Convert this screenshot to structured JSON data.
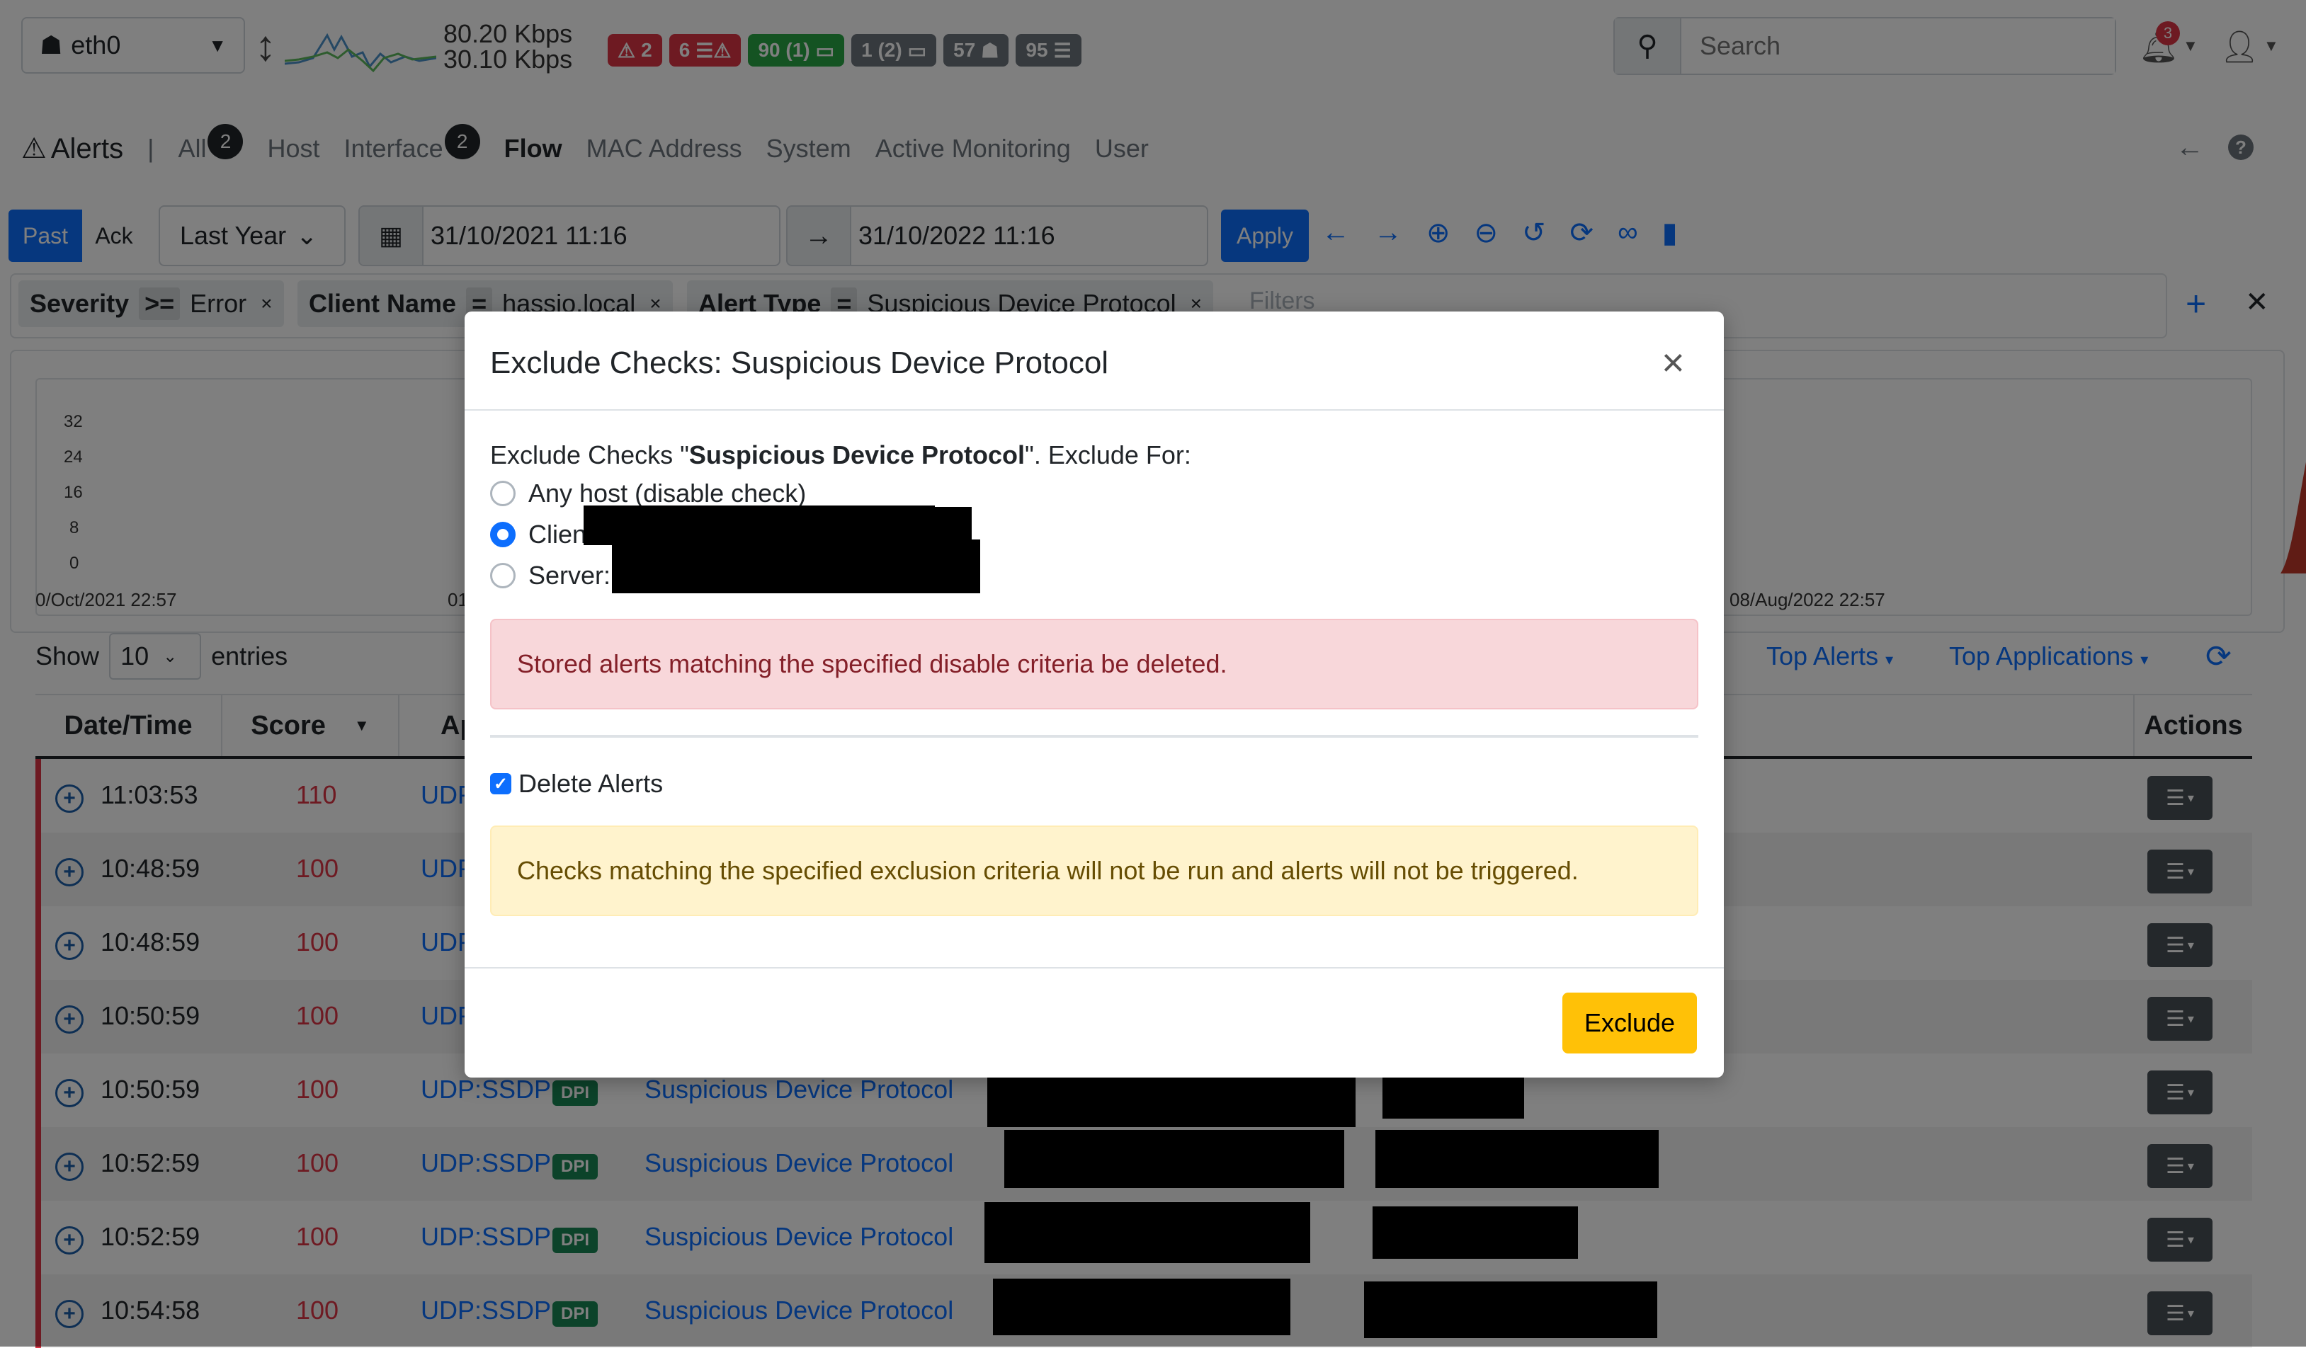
{
  "topbar": {
    "interface": "eth0",
    "traffic_up": "80.20 Kbps",
    "traffic_down": "30.10 Kbps",
    "badges": [
      {
        "text": "2",
        "icon": "warning-icon",
        "color": "#dc3545"
      },
      {
        "text": "6",
        "icon": "flows-warning-icon",
        "color": "#dc3545"
      },
      {
        "text": "90 (1)",
        "icon": "laptop-icon",
        "color": "#28a745"
      },
      {
        "text": "1 (2)",
        "icon": "laptop-icon",
        "color": "#6c757d"
      },
      {
        "text": "57",
        "icon": "device-icon",
        "color": "#6c757d"
      },
      {
        "text": "95",
        "icon": "flows-icon",
        "color": "#6c757d"
      }
    ],
    "search_placeholder": "Search",
    "notifications_count": "3"
  },
  "nav": {
    "title": "Alerts",
    "sep": "|",
    "items": [
      {
        "label": "All",
        "count": "2"
      },
      {
        "label": "Host"
      },
      {
        "label": "Interface",
        "count": "2"
      },
      {
        "label": "Flow",
        "active": true
      },
      {
        "label": "MAC Address"
      },
      {
        "label": "System"
      },
      {
        "label": "Active Monitoring"
      },
      {
        "label": "User"
      }
    ]
  },
  "toolbar": {
    "past_label": "Past",
    "ack_label": "Ack",
    "range": "Last Year",
    "date_from": "31/10/2021 11:16",
    "date_to": "31/10/2022 11:16",
    "apply_label": "Apply"
  },
  "filters": {
    "chips": [
      {
        "field": "Severity",
        "op": ">=",
        "value": "Error"
      },
      {
        "field": "Client Name",
        "op": "=",
        "value": "hassio.local"
      },
      {
        "field": "Alert Type",
        "op": "=",
        "value": "Suspicious Device Protocol"
      }
    ],
    "placeholder": "Filters"
  },
  "chart_data": {
    "type": "area",
    "y_ticks": [
      "32",
      "24",
      "16",
      "8",
      "0"
    ],
    "x_ticks": [
      "0/Oct/2021 22:57",
      "01",
      "08/Aug/2022 22:57"
    ],
    "series_color": "#c0392b"
  },
  "table_controls": {
    "show": "Show",
    "entries_value": "10",
    "entries": "entries",
    "top_alerts": "Top Alerts",
    "top_applications": "Top Applications"
  },
  "table": {
    "headers": {
      "datetime": "Date/Time",
      "score": "Score",
      "app": "Ap",
      "actions": "Actions"
    },
    "rows": [
      {
        "time": "11:03:53",
        "score": "110",
        "proto": "UDP",
        "dpi": "",
        "type": ""
      },
      {
        "time": "10:48:59",
        "score": "100",
        "proto": "UDP",
        "dpi": "",
        "type": ""
      },
      {
        "time": "10:48:59",
        "score": "100",
        "proto": "UDP",
        "dpi": "",
        "type": ""
      },
      {
        "time": "10:50:59",
        "score": "100",
        "proto": "UDP",
        "dpi": "",
        "type": ""
      },
      {
        "time": "10:50:59",
        "score": "100",
        "proto": "UDP:SSDP",
        "dpi": "DPI",
        "type": "Suspicious Device Protocol"
      },
      {
        "time": "10:52:59",
        "score": "100",
        "proto": "UDP:SSDP",
        "dpi": "DPI",
        "type": "Suspicious Device Protocol"
      },
      {
        "time": "10:52:59",
        "score": "100",
        "proto": "UDP:SSDP",
        "dpi": "DPI",
        "type": "Suspicious Device Protocol"
      },
      {
        "time": "10:54:58",
        "score": "100",
        "proto": "UDP:SSDP",
        "dpi": "DPI",
        "type": "Suspicious Device Protocol"
      }
    ]
  },
  "modal": {
    "title": "Exclude Checks: Suspicious Device Protocol",
    "desc_prefix": "Exclude Checks \"",
    "desc_bold": "Suspicious Device Protocol",
    "desc_suffix": "\". Exclude For:",
    "options": [
      {
        "label": "Any host (disable check)",
        "checked": false
      },
      {
        "label": "Clien",
        "checked": true
      },
      {
        "label": "Server:",
        "checked": false
      }
    ],
    "danger_text": "Stored alerts matching the specified disable criteria be deleted.",
    "delete_alerts_label": "Delete Alerts",
    "warn_text": "Checks matching the specified exclusion criteria will not be run and alerts will not be triggered.",
    "exclude_label": "Exclude"
  }
}
